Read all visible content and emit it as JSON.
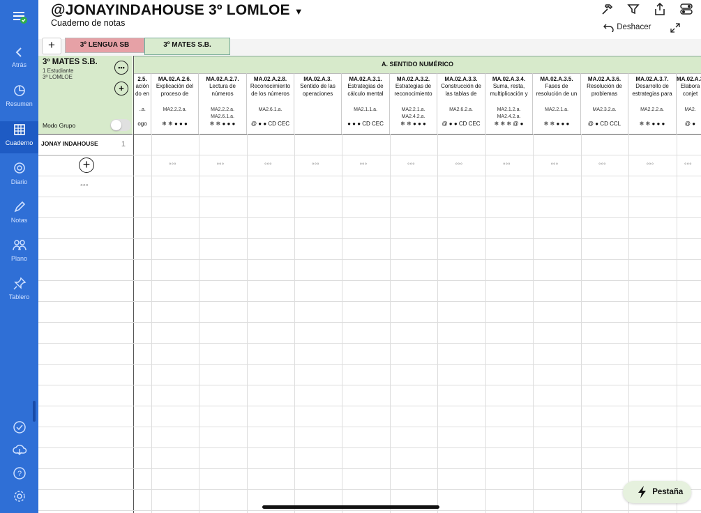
{
  "sidebar": {
    "items": [
      {
        "label": "Atrás",
        "icon": "chevron-left-icon"
      },
      {
        "label": "Resumen",
        "icon": "pie-chart-icon"
      },
      {
        "label": "Cuaderno",
        "icon": "grid-icon"
      },
      {
        "label": "Diario",
        "icon": "chat-bubble-icon"
      },
      {
        "label": "Notas",
        "icon": "pencil-icon"
      },
      {
        "label": "Plano",
        "icon": "people-icon"
      },
      {
        "label": "Tablero",
        "icon": "pin-icon"
      }
    ],
    "bottom_icons": [
      "checkmark-circle-icon",
      "cloud-icon",
      "help-icon",
      "settings-icon"
    ]
  },
  "header": {
    "title": "@JONAYINDAHOUSE 3º LOMLOE",
    "caret": "▼",
    "subtitle": "Cuaderno de notas",
    "undo_label": "Deshacer"
  },
  "tabs": {
    "add": "+",
    "items": [
      "3º LENGUA SB",
      "3º MATES S.B."
    ]
  },
  "group": {
    "title": "3º MATES S.B.",
    "students": "1 Estudiante",
    "course": "3º LOMLOE",
    "more_button": "•••",
    "add_button": "+",
    "modo_label": "Modo Grupo"
  },
  "section_title": "A. SENTIDO NUMÉRICO",
  "columns": [
    {
      "code": "2.5.",
      "name": "ación do en",
      "crit": "..a.",
      "icons": "ogo"
    },
    {
      "code": "MA.02.A.2.6.",
      "name": "Explicación del proceso de",
      "crit": "MA2.2.2.a.",
      "icons": "❄ ❄ ● ● ●"
    },
    {
      "code": "MA.02.A.2.7.",
      "name": "Lectura de números",
      "crit": "MA2.2.2.a. MA2.6.1.a.",
      "icons": "❄ ❄ ● ● ●"
    },
    {
      "code": "MA.02.A.2.8.",
      "name": "Reconocimiento de los números",
      "crit": "MA2.6.1.a.",
      "icons": "@ ● ● CD CEC"
    },
    {
      "code": "MA.02.A.3.",
      "name": "Sentido de las operaciones",
      "crit": "",
      "icons": ""
    },
    {
      "code": "MA.02.A.3.1.",
      "name": "Estrategias de cálculo mental",
      "crit": "MA2.1.1.a.",
      "icons": "● ● ● CD CEC"
    },
    {
      "code": "MA.02.A.3.2.",
      "name": "Estrategias de reconocimiento",
      "crit": "MA2.2.1.a. MA2.4.2.a.",
      "icons": "❄ ❄ ● ● ●"
    },
    {
      "code": "MA.02.A.3.3.",
      "name": "Construcción de las tablas de",
      "crit": "MA2.6.2.a.",
      "icons": "@ ● ● CD CEC"
    },
    {
      "code": "MA.02.A.3.4.",
      "name": "Suma, resta, multiplicación y",
      "crit": "MA2.1.2.a. MA2.4.2.a.",
      "icons": "❄ ❄ ❄ @ ●"
    },
    {
      "code": "MA.02.A.3.5.",
      "name": "Fases de resolución de un",
      "crit": "MA2.2.1.a.",
      "icons": "❄ ❄ ● ● ●"
    },
    {
      "code": "MA.02.A.3.6.",
      "name": "Resolución de problemas",
      "crit": "MA2.3.2.a.",
      "icons": "@ ● CD CCL"
    },
    {
      "code": "MA.02.A.3.7.",
      "name": "Desarrollo de estrategias para",
      "crit": "MA2.2.2.a.",
      "icons": "❄ ❄ ● ● ●"
    },
    {
      "code": "MA.02.A.3.8.",
      "name": "Elabora conjet",
      "crit": "MA2.",
      "icons": "@ ●"
    }
  ],
  "students": [
    {
      "name": "JONAY INDAHOUSE",
      "count": "1"
    }
  ],
  "add_student": "+",
  "row_dots": "◦◦◦",
  "cell_dots": "◦◦◦",
  "pestana_label": "Pestaña"
}
